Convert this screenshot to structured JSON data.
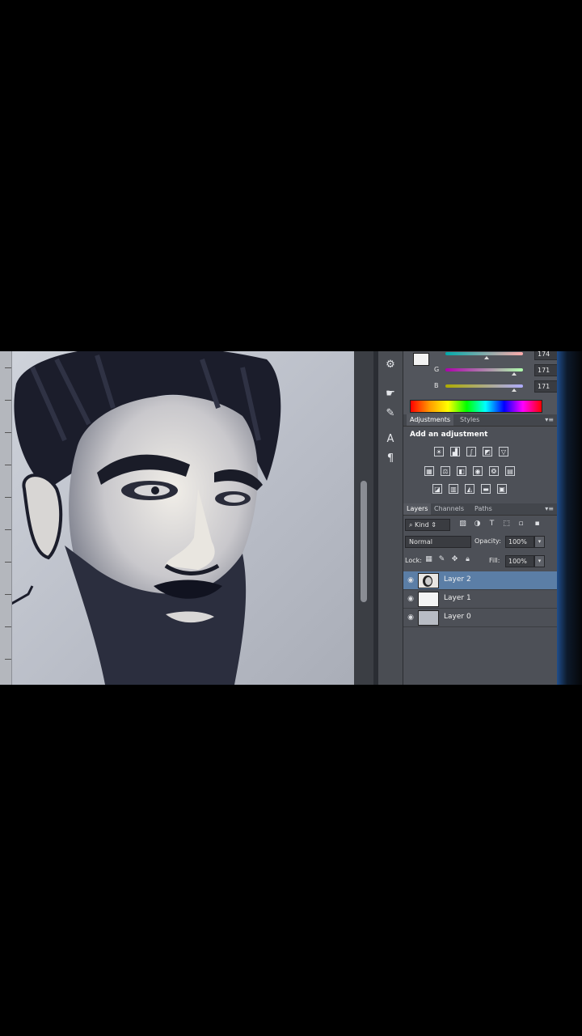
{
  "color_panel": {
    "rows": [
      {
        "label": "",
        "value": "174"
      },
      {
        "label": "G",
        "value": "171"
      },
      {
        "label": "B",
        "value": "171"
      }
    ]
  },
  "adjustments_tabs": [
    {
      "label": "Adjustments",
      "active": true
    },
    {
      "label": "Styles",
      "active": false
    }
  ],
  "adjustments_title": "Add an adjustment",
  "adjustment_icons": [
    [
      "brightness-contrast-icon",
      "levels-icon",
      "curves-icon",
      "exposure-icon",
      "vibrance-icon"
    ],
    [
      "hue-saturation-icon",
      "color-balance-icon",
      "black-white-icon",
      "photo-filter-icon",
      "channel-mixer-icon",
      "color-lookup-icon"
    ],
    [
      "invert-icon",
      "posterize-icon",
      "threshold-icon",
      "gradient-map-icon",
      "selective-color-icon"
    ]
  ],
  "layers_tabs": [
    {
      "label": "Layers",
      "active": true
    },
    {
      "label": "Channels",
      "active": false
    },
    {
      "label": "Paths",
      "active": false
    }
  ],
  "layers_filter": {
    "kind": "Kind"
  },
  "blend": {
    "mode": "Normal",
    "opacity_label": "Opacity:",
    "opacity_value": "100%",
    "lock_label": "Lock:",
    "fill_label": "Fill:",
    "fill_value": "100%"
  },
  "layers": [
    {
      "name": "Layer 2",
      "selected": true
    },
    {
      "name": "Layer 1",
      "selected": false
    },
    {
      "name": "Layer 0",
      "selected": false
    }
  ]
}
